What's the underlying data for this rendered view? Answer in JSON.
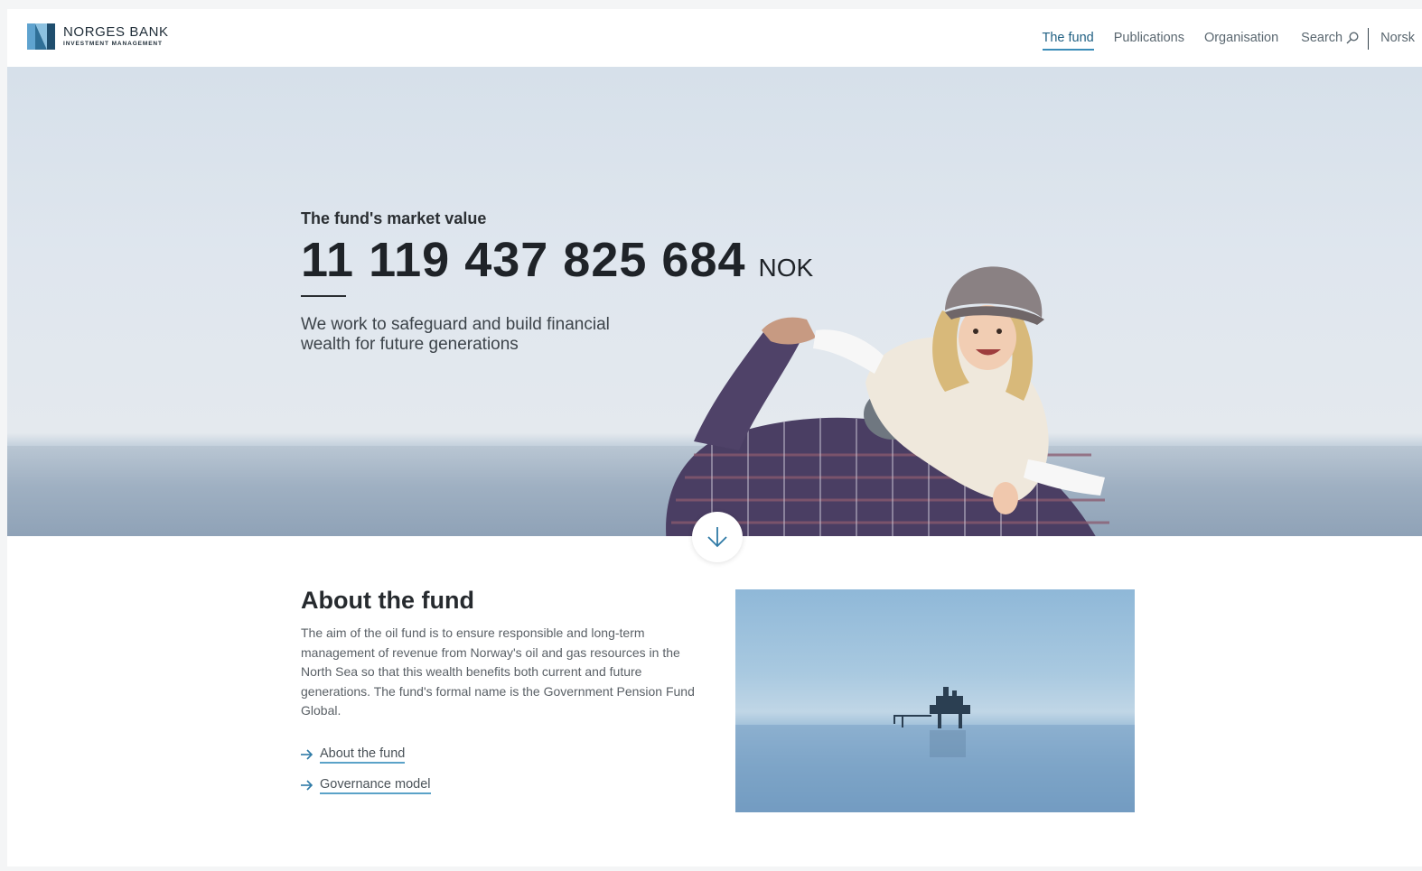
{
  "brand": {
    "name": "NORGES BANK",
    "sub": "INVESTMENT MANAGEMENT",
    "colors": {
      "accent": "#3a8cb8",
      "logo_dark": "#1f4e6e",
      "logo_light": "#5fa3cf"
    }
  },
  "nav": {
    "items": [
      {
        "label": "The fund",
        "active": true
      },
      {
        "label": "Publications",
        "active": false
      },
      {
        "label": "Organisation",
        "active": false
      }
    ],
    "search_label": "Search",
    "search_icon": "search-icon",
    "language_label": "Norsk"
  },
  "hero": {
    "market_value_label": "The fund's market value",
    "market_value": "11 119 437 825 684",
    "currency": "NOK",
    "tagline": "We work to safeguard and build financial wealth for future generations",
    "scroll_icon": "arrow-down-icon"
  },
  "about": {
    "title": "About the fund",
    "body": "The aim of the oil fund is to ensure responsible and long-term management of revenue from Norway's oil and gas resources in the North Sea so that this wealth benefits both current and future generations. The fund's formal name is the Government Pension Fund Global.",
    "links": [
      {
        "label": "About the fund",
        "icon": "arrow-right-icon"
      },
      {
        "label": "Governance model",
        "icon": "arrow-right-icon"
      }
    ]
  }
}
